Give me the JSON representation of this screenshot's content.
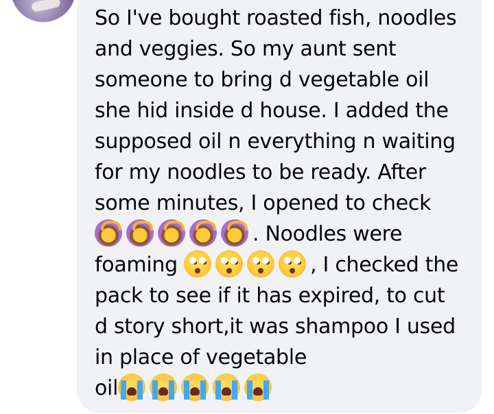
{
  "comment": {
    "author_avatar_icon": "profile-photo",
    "bubble_color": "#f0f2f5",
    "text_color": "#050505",
    "lines": [
      "So I've bought roasted fish, noodles",
      "and veggies. So my aunt sent",
      "someone to bring d vegetable oil",
      "she hid inside d house. I added the",
      "supposed oil n everything n waiting",
      "for my noodles to be ready. After",
      "some minutes, I opened to check"
    ],
    "line8_text": ". Noodles were",
    "line9_lead": "foaming",
    "line9_text": ", I checked the",
    "lines_after": [
      "pack to see if it has expired, to cut",
      "d story short,it was shampoo I used",
      "in place of vegetable"
    ],
    "final_word": "oil",
    "emoji_rows": {
      "gesturing_no": [
        "person-gesturing-no-icon",
        "person-gesturing-no-icon",
        "person-gesturing-no-icon",
        "person-gesturing-no-icon",
        "person-gesturing-no-icon"
      ],
      "flushed": [
        "flushed-face-icon",
        "flushed-face-icon",
        "flushed-face-icon",
        "flushed-face-icon"
      ],
      "crying": [
        "loudly-crying-face-icon",
        "loudly-crying-face-icon",
        "loudly-crying-face-icon",
        "loudly-crying-face-icon",
        "loudly-crying-face-icon"
      ]
    }
  }
}
